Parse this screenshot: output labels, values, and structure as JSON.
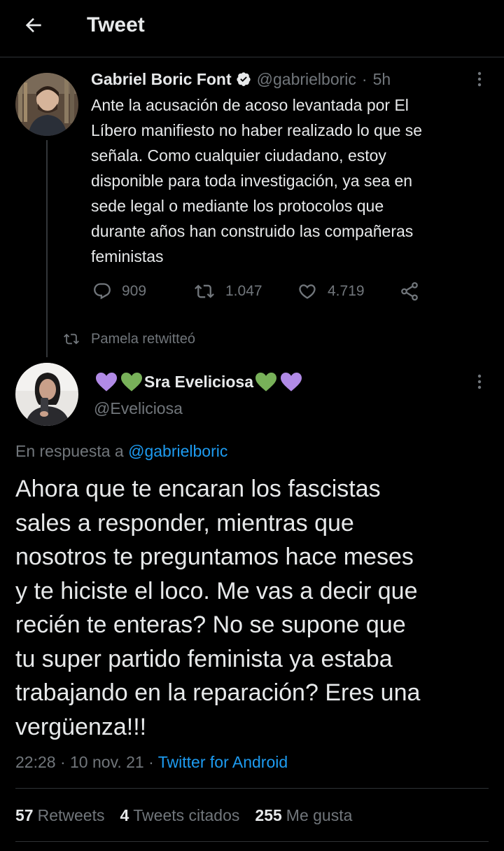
{
  "header": {
    "title": "Tweet",
    "back_icon": "arrow-left-icon"
  },
  "original_tweet": {
    "author_name": "Gabriel Boric Font",
    "verified": true,
    "handle": "@gabrielboric",
    "separator": "·",
    "time_ago": "5h",
    "text": "Ante la acusación de acoso levantada por El\nLíbero manifiesto no haber realizado lo que se\nseñala. Como cualquier ciudadano, estoy\ndisponible para toda investigación, ya sea en\nsede legal o mediante los protocolos que\ndurante años han construido las compañeras\nfeministas",
    "replies": "909",
    "retweets": "1.047",
    "likes": "4.719"
  },
  "retweet_note": "Pamela retwitteó",
  "reply_tweet": {
    "author_name": "Sra Eveliciosa",
    "handle": "@Eveliciosa",
    "reply_prefix": "En respuesta a",
    "reply_mention": "@gabrielboric",
    "text": "Ahora que te encaran los fascistas\nsales a responder, mientras que\nnosotros te preguntamos hace meses\ny te hiciste el loco. Me vas a decir que\nrecién te enteras? No se supone que\ntu super partido feminista ya estaba\ntrabajando en la reparación?  Eres una\nvergüenza!!!",
    "time": "22:28",
    "date": "10 nov. 21",
    "separator": "·",
    "source": "Twitter for Android"
  },
  "stats": {
    "retweets_count": "57",
    "retweets_label": "Retweets",
    "quotes_count": "4",
    "quotes_label": "Tweets citados",
    "likes_count": "255",
    "likes_label": "Me gusta"
  },
  "colors": {
    "background": "#000000",
    "text": "#e7e9ea",
    "muted": "#71767b",
    "link": "#1d9bf0",
    "verified": "#e7e9ea",
    "heart_purple": "#b18ae6",
    "heart_green": "#78b159"
  }
}
